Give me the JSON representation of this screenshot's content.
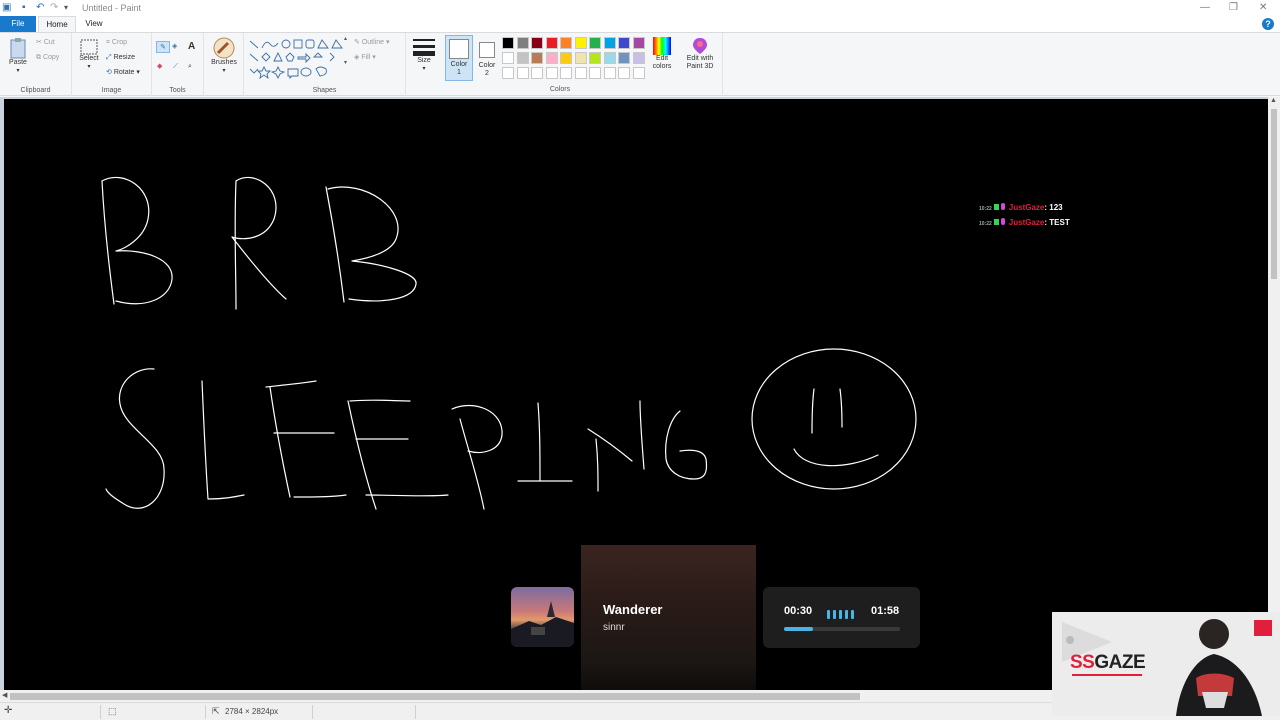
{
  "window": {
    "title": "Untitled - Paint"
  },
  "menu": {
    "file": "File",
    "tabs": [
      "Home",
      "View"
    ]
  },
  "ribbon": {
    "clipboard": {
      "label": "Clipboard",
      "paste": "Paste",
      "cut": "Cut",
      "copy": "Copy"
    },
    "image": {
      "label": "Image",
      "select": "Select",
      "crop": "Crop",
      "resize": "Resize",
      "rotate": "Rotate"
    },
    "tools": {
      "label": "Tools"
    },
    "brushes": {
      "label": "Brushes"
    },
    "shapes": {
      "label": "Shapes",
      "outline": "Outline",
      "fill": "Fill"
    },
    "size": {
      "label": "Size"
    },
    "color1": {
      "label": "Color",
      "num": "1"
    },
    "color2": {
      "label": "Color",
      "num": "2"
    },
    "colors": {
      "label": "Colors"
    },
    "edit_colors": {
      "line1": "Edit",
      "line2": "colors"
    },
    "paint3d": {
      "line1": "Edit with",
      "line2": "Paint 3D"
    },
    "palette_row1": [
      "#000000",
      "#7f7f7f",
      "#880015",
      "#ed1c24",
      "#ff7f27",
      "#fff200",
      "#22b14c",
      "#00a2e8",
      "#3f48cc",
      "#a349a4"
    ],
    "palette_row2": [
      "#ffffff",
      "#c3c3c3",
      "#b97a57",
      "#ffaec9",
      "#ffc90e",
      "#efe4b0",
      "#b5e61d",
      "#99d9ea",
      "#7092be",
      "#c8bfe7"
    ]
  },
  "status": {
    "dimensions": "2784 × 2824px"
  },
  "chat": [
    {
      "time": "10:22",
      "user": "JustGaze",
      "message": ": 123"
    },
    {
      "time": "10:22",
      "user": "JustGaze",
      "message": ": TEST"
    }
  ],
  "music": {
    "title": "Wanderer",
    "artist": "sinnr",
    "elapsed": "00:30",
    "duration": "01:58",
    "progress": 0.25
  },
  "webcam": {
    "logo_prefix": "SS",
    "logo_suffix": "GAZE"
  }
}
